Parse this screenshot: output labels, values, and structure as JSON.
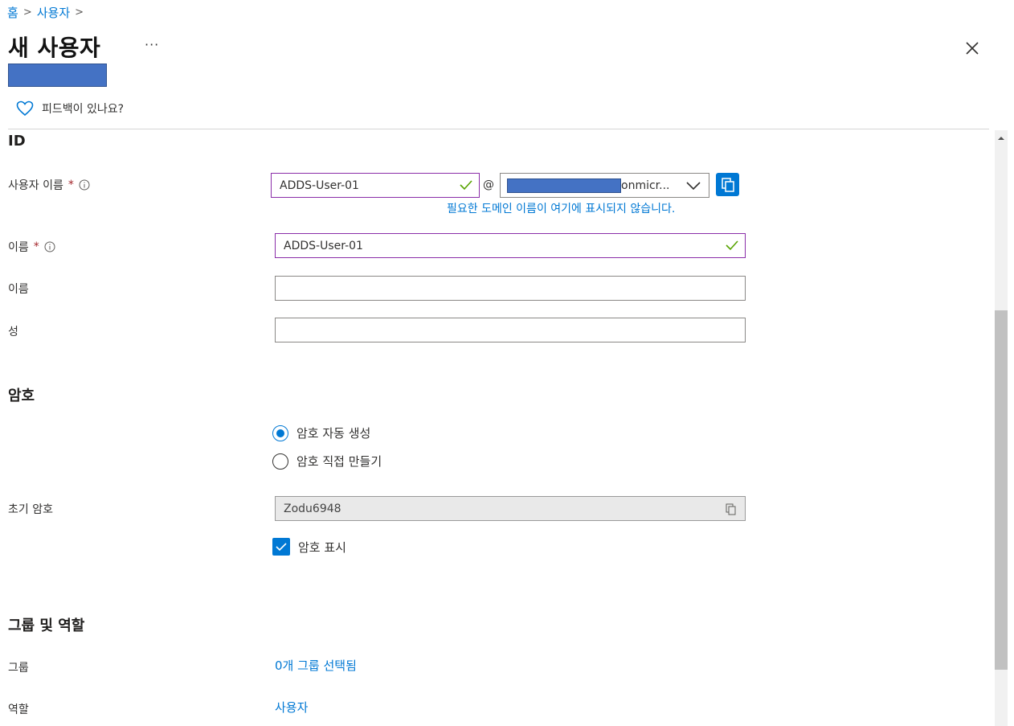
{
  "breadcrumb": {
    "home": "홈",
    "users": "사용자"
  },
  "header": {
    "title": "새 사용자",
    "more": "···"
  },
  "feedback": {
    "label": "피드백이 있나요?"
  },
  "identity": {
    "section_title": "ID",
    "username": {
      "label": "사용자 이름",
      "required_mark": "*",
      "value": "ADDS-User-01",
      "at": "@",
      "domain_suffix": "onmicr...",
      "helper_link": "필요한 도메인 이름이 여기에 표시되지 않습니다."
    },
    "name": {
      "label": "이름",
      "required_mark": "*",
      "value": "ADDS-User-01"
    },
    "first_name": {
      "label": "이름",
      "value": ""
    },
    "last_name": {
      "label": "성",
      "value": ""
    }
  },
  "password": {
    "section_title": "암호",
    "options": [
      {
        "label": "암호 자동 생성",
        "selected": true
      },
      {
        "label": "암호 직접 만들기",
        "selected": false
      }
    ],
    "initial_label": "초기 암호",
    "initial_value": "Zodu6948",
    "show_label": "암호 표시",
    "show_checked": true
  },
  "groups_roles": {
    "section_title": "그룹 및 역할",
    "groups_label": "그룹",
    "groups_value": "0개 그룹 선택됨",
    "roles_label": "역할",
    "roles_value": "사용자"
  },
  "colors": {
    "accent": "#0078d4",
    "valid_border": "#8a2da8",
    "redaction": "#4472c4",
    "required": "#a4262c"
  }
}
